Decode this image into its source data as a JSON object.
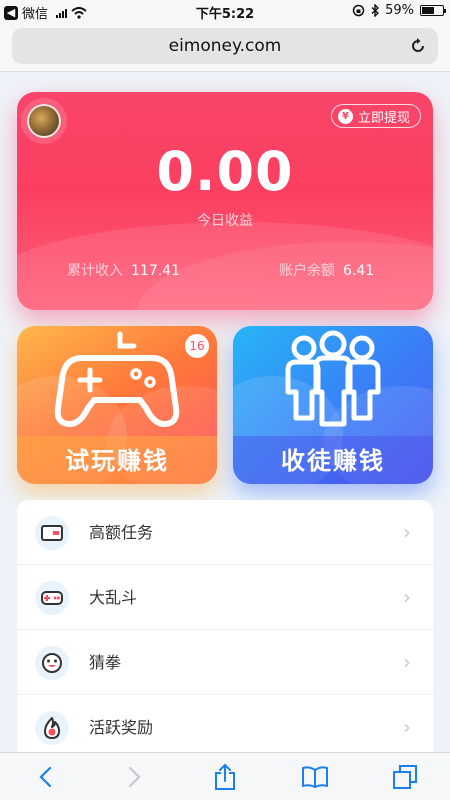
{
  "status_bar": {
    "carrier": "微信",
    "time": "下午5:22",
    "battery_percent": "59%",
    "battery_level": 0.59
  },
  "browser": {
    "url": "eimoney.com"
  },
  "earnings": {
    "withdraw_label": "立即提现",
    "withdraw_icon_symbol": "¥",
    "today_amount": "0.00",
    "today_label": "今日收益",
    "total_income_label": "累计收入",
    "total_income_value": "117.41",
    "balance_label": "账户余额",
    "balance_value": "6.41"
  },
  "features": {
    "trial": {
      "title": "试玩赚钱",
      "badge": "16",
      "icon": "gamepad-icon"
    },
    "apprentice": {
      "title": "收徒赚钱",
      "icon": "people-group-icon"
    }
  },
  "menu": [
    {
      "label": "高额任务",
      "icon": "card-icon"
    },
    {
      "label": "大乱斗",
      "icon": "gamepad-small-icon"
    },
    {
      "label": "猜拳",
      "icon": "smiley-icon"
    },
    {
      "label": "活跃奖励",
      "icon": "flame-icon"
    }
  ],
  "colors": {
    "earn_card": "#fb3f60",
    "trial_card": "#ff7a3a",
    "apprentice_card": "#3a7ff7",
    "menu_icon_accent": "#ff4b60",
    "toolbar_accent": "#1a7ff0"
  }
}
